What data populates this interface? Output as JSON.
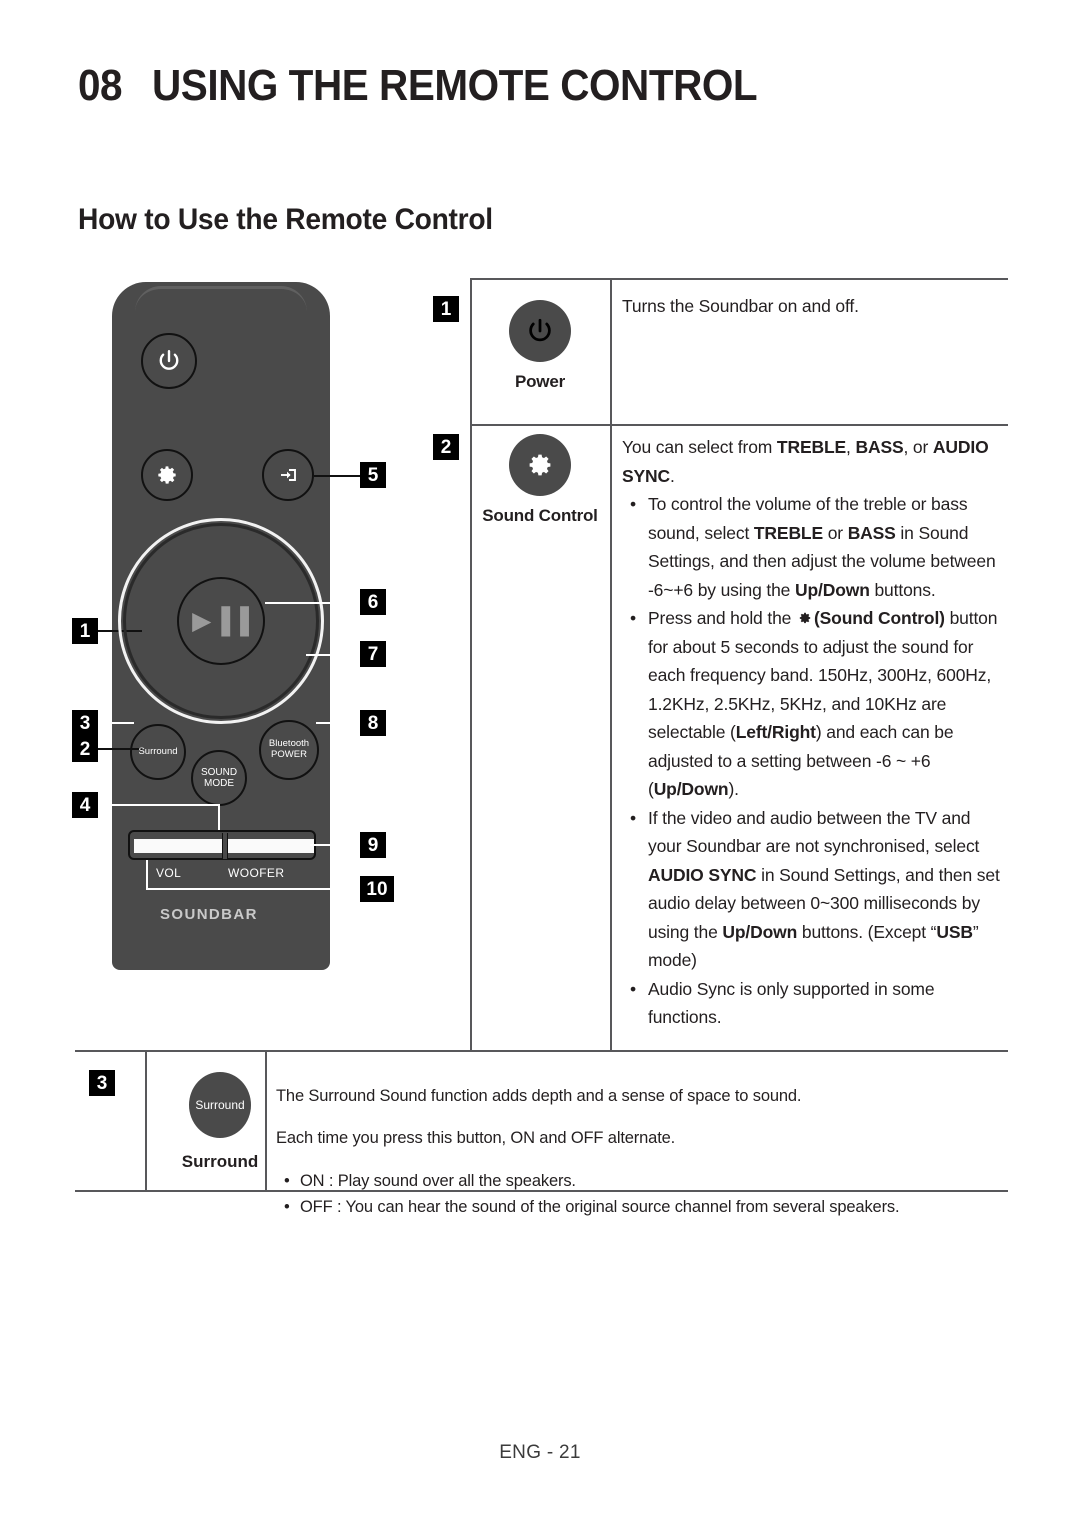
{
  "header": {
    "chapter_number": "08",
    "chapter_title": "USING THE REMOTE CONTROL",
    "section_title": "How to Use the Remote Control"
  },
  "remote": {
    "brand_label": "SOUNDBAR",
    "buttons": {
      "power": "power-icon",
      "sound_control": "gear-icon",
      "source": "source-input-icon",
      "play_pause": "▶▐▐",
      "surround": "Surround",
      "sound_mode_line1": "SOUND",
      "sound_mode_line2": "MODE",
      "bluetooth_line1": "Bluetooth",
      "bluetooth_line2": "POWER",
      "vol": "VOL",
      "woofer": "WOOFER"
    },
    "callouts": {
      "n1": "1",
      "n2": "2",
      "n3": "3",
      "n4": "4",
      "n5": "5",
      "n6": "6",
      "n7": "7",
      "n8": "8",
      "n9": "9",
      "n10": "10"
    }
  },
  "table": {
    "rows": [
      {
        "number": "1",
        "name": "Power",
        "icon": "power-icon",
        "description": "Turns the Soundbar on and off."
      },
      {
        "number": "2",
        "name": "Sound Control",
        "icon": "gear-icon",
        "intro_prefix": "You can select from ",
        "intro_b1": "TREBLE",
        "intro_mid1": ", ",
        "intro_b2": "BASS",
        "intro_mid2": ", or ",
        "intro_b3": "AUDIO SYNC",
        "intro_suffix": ".",
        "bullets": [
          {
            "p1": "To control the volume of the treble or bass sound, select ",
            "b1": "TREBLE",
            "p2": " or ",
            "b2": "BASS",
            "p3": " in Sound Settings, and then adjust the volume between -6~+6 by using the ",
            "b3": "Up/Down",
            "p4": " buttons."
          },
          {
            "p1": "Press and hold the ",
            "icon": "gear-icon",
            "b1": "(Sound Control)",
            "p2": " button for about 5 seconds to adjust the sound for each frequency band. 150Hz, 300Hz, 600Hz, 1.2KHz, 2.5KHz, 5KHz, and 10KHz are selectable (",
            "b2": "Left/Right",
            "p3": ") and each can be adjusted to a setting between -6 ~ +6 (",
            "b3": "Up/Down",
            "p4": ")."
          },
          {
            "p1": "If the video and audio between the TV and your Soundbar are not synchronised, select ",
            "b1": "AUDIO SYNC",
            "p2": " in Sound Settings, and then set audio delay between 0~300 milliseconds by using the ",
            "b2": "Up/Down",
            "p3": " buttons. (Except “",
            "b3": "USB",
            "p4": "” mode)"
          },
          {
            "p1": "Audio Sync is only supported in some functions."
          }
        ]
      },
      {
        "number": "3",
        "name": "Surround",
        "icon": "surround-button",
        "icon_label": "Surround",
        "line1": "The Surround Sound function adds depth and a sense of space to sound.",
        "line2": "Each time you press this button, ON and OFF alternate.",
        "bullets": [
          "ON : Play sound over all the speakers.",
          "OFF : You can hear the sound of the original source channel from several speakers."
        ]
      }
    ]
  },
  "footer": {
    "page_label": "ENG - 21"
  }
}
